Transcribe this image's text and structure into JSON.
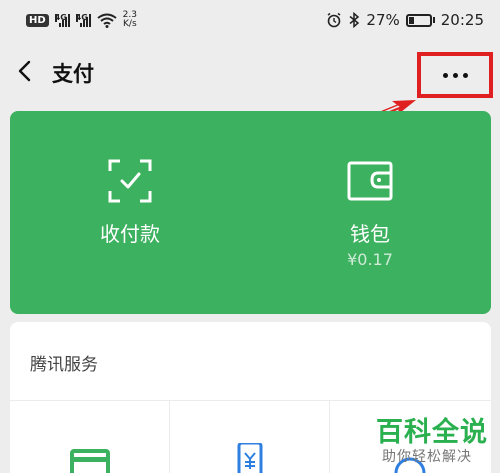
{
  "status_bar": {
    "hd": "HD",
    "net_tag_1": "4G",
    "net_tag_2": "4G",
    "speed_value": "2.3",
    "speed_unit": "K/s",
    "battery_percent": "27%",
    "battery_level": 0.27,
    "time": "20:25",
    "icons": [
      "hd-icon",
      "signal-icon",
      "signal-icon",
      "wifi-icon",
      "alarm-icon",
      "bluetooth-icon",
      "battery-icon"
    ]
  },
  "nav": {
    "title": "支付",
    "back_icon": "chevron-left-icon",
    "more_icon": "more-dots-icon"
  },
  "annotation": {
    "color": "#e02020"
  },
  "wallet_card": {
    "background": "#3cb15f",
    "items": [
      {
        "label": "收付款",
        "icon": "scan-check-icon"
      },
      {
        "label": "钱包",
        "icon": "wallet-icon",
        "amount": "¥0.17"
      }
    ]
  },
  "services": {
    "title": "腾讯服务",
    "items": [
      {
        "icon": "card-icon"
      },
      {
        "icon": "phone-recharge-icon"
      },
      {
        "icon": "service-icon"
      }
    ]
  },
  "watermark": {
    "title": "百科全说",
    "subtitle": "助你轻松解决",
    "color": "#2bb050"
  }
}
